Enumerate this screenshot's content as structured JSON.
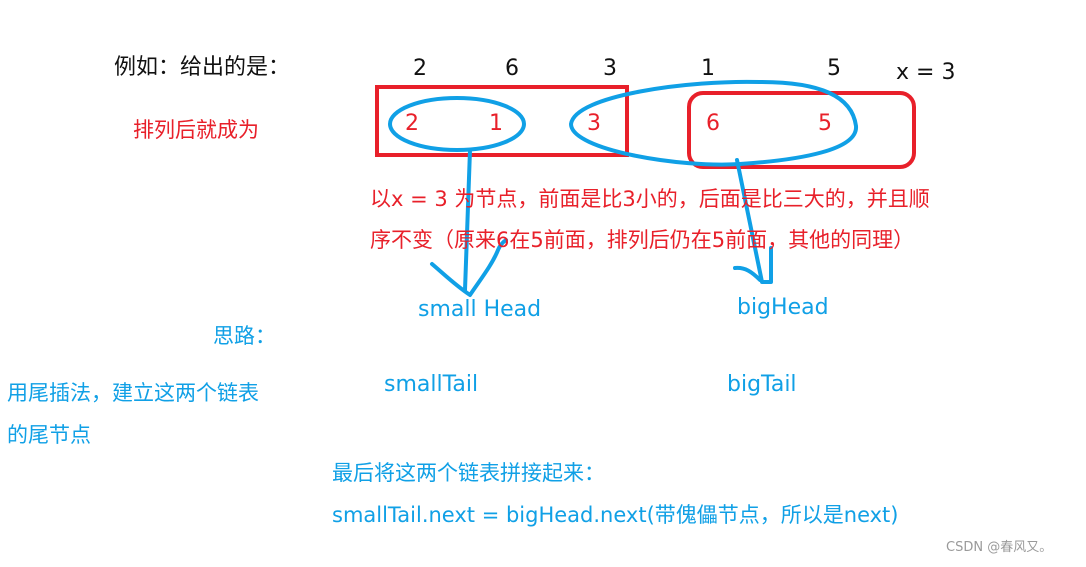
{
  "example_label": "例如：给出的是：",
  "input_sequence": [
    "2",
    "6",
    "3",
    "1",
    "5"
  ],
  "pivot_label": "x = 3",
  "after_label": "排列后就成为",
  "result_sequence": {
    "small_part": [
      "2",
      "1",
      "3"
    ],
    "big_part": [
      "6",
      "5"
    ]
  },
  "explanation": {
    "line1": "以x = 3 为节点，前面是比3小的，后面是比三大的，并且顺",
    "line2": "序不变（原来6在5前面，排列后仍在5前面，其他的同理）"
  },
  "pointers": {
    "small_head": "small Head",
    "big_head": "bigHead",
    "small_tail": "smallTail",
    "big_tail": "bigTail"
  },
  "idea": {
    "title": "思路：",
    "line1": "用尾插法，建立这两个链表",
    "line2": "的尾节点"
  },
  "conclusion": {
    "line1": "最后将这两个链表拼接起来：",
    "line2": "smallTail.next = bigHead.next(带傀儡节点，所以是next)"
  },
  "watermark": "CSDN @春风又。",
  "colors": {
    "red": "#e8202a",
    "blue": "#10a0e6",
    "black": "#111111"
  }
}
